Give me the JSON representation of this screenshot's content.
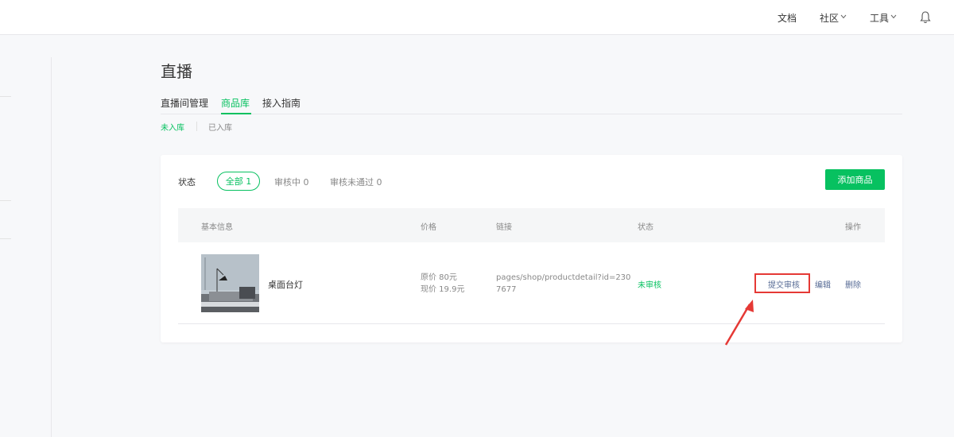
{
  "topnav": {
    "docs": "文档",
    "community": "社区",
    "tools": "工具"
  },
  "page": {
    "title": "直播"
  },
  "tabs": [
    {
      "label": "直播间管理"
    },
    {
      "label": "商品库"
    },
    {
      "label": "接入指南"
    }
  ],
  "subtabs": [
    {
      "label": "未入库"
    },
    {
      "label": "已入库"
    }
  ],
  "filters": {
    "label": "状态",
    "options": [
      {
        "label": "全部 1"
      },
      {
        "label": "审核中 0"
      },
      {
        "label": "审核未通过 0"
      }
    ]
  },
  "add_button": "添加商品",
  "table": {
    "columns": [
      "基本信息",
      "价格",
      "链接",
      "状态",
      "操作"
    ],
    "rows": [
      {
        "name": "桌面台灯",
        "original_price": "原价 80元",
        "current_price": "现价 19.9元",
        "link": "pages/shop/productdetail?id=2307677",
        "status": "未审核",
        "actions": [
          "提交审核",
          "编辑",
          "删除"
        ]
      }
    ]
  },
  "colors": {
    "accent": "#07c160",
    "link": "#576b95",
    "annotation": "#e53935"
  }
}
